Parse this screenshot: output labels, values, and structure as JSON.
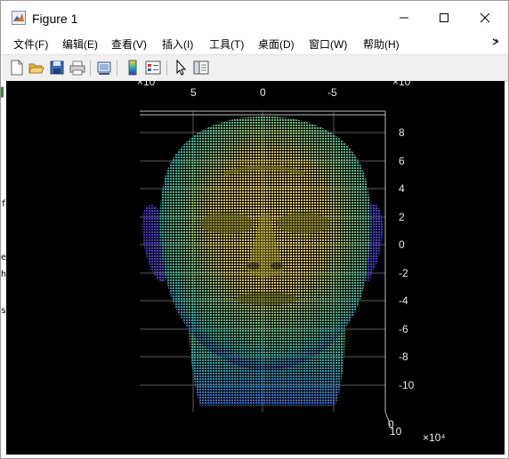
{
  "window": {
    "title": "Figure 1",
    "minimize_label": "minimize",
    "maximize_label": "maximize",
    "close_label": "close"
  },
  "menu": {
    "items": [
      {
        "label": "文件(F)"
      },
      {
        "label": "编辑(E)"
      },
      {
        "label": "查看(V)"
      },
      {
        "label": "插入(I)"
      },
      {
        "label": "工具(T)"
      },
      {
        "label": "桌面(D)"
      },
      {
        "label": "窗口(W)"
      },
      {
        "label": "帮助(H)"
      }
    ],
    "overflow_icon": "chevron-right-icon"
  },
  "toolbar": {
    "buttons": [
      {
        "icon": "new-figure-icon"
      },
      {
        "icon": "open-file-icon"
      },
      {
        "icon": "save-icon"
      },
      {
        "icon": "print-icon"
      },
      {
        "icon": "link-plot-icon"
      },
      {
        "icon": "colorbar-icon"
      },
      {
        "icon": "legend-icon"
      },
      {
        "icon": "pointer-icon"
      },
      {
        "icon": "property-inspector-icon"
      }
    ]
  },
  "left_strip": {
    "chars": [
      "f",
      "e",
      "h",
      "s"
    ]
  },
  "colors": {
    "background": "#000000",
    "tick": "#e8e8e8",
    "colormap_low": "#3b2cc8",
    "colormap_mid": "#1fb7a6",
    "colormap_high": "#f2d53c"
  },
  "chart_data": {
    "type": "scatter",
    "x_ticks": [
      "5",
      "0",
      "-5"
    ],
    "x_exponent_label": "×10",
    "y_ticks": [
      "8",
      "6",
      "4",
      "2",
      "0",
      "-2",
      "-4",
      "-6",
      "-8",
      "-10"
    ],
    "y_exponent_label": "×10",
    "z_ticks": [
      "0",
      "10"
    ],
    "z_exponent_label": "×10⁴",
    "grid": true
  }
}
